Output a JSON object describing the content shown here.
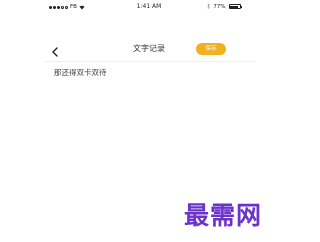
{
  "status_bar": {
    "carrier": "FB",
    "time": "1:41 AM",
    "battery_percent_label": "77%",
    "battery_level": 0.77
  },
  "nav": {
    "title": "文字记录",
    "save_label": "保存"
  },
  "content": {
    "note_text": "那还得双卡双待"
  },
  "watermark": {
    "text": "最需网"
  },
  "colors": {
    "accent": "#f2b01f",
    "watermark": "#6a33c9"
  }
}
